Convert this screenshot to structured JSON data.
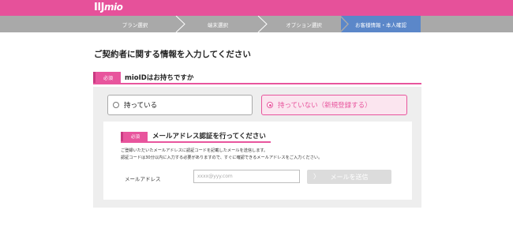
{
  "header": {
    "logo_main": "IIJ",
    "logo_sub": "mio"
  },
  "steps": [
    {
      "label": "プラン選択"
    },
    {
      "label": "端末選択"
    },
    {
      "label": "オプション選択"
    },
    {
      "label": "お客様情報・本人確認",
      "active": true
    }
  ],
  "page": {
    "title": "ご契約者に関する情報を入力してください"
  },
  "mioid_section": {
    "badge": "必須",
    "question": "mioIDはお持ちですか",
    "options": [
      {
        "label": "持っている",
        "selected": false
      },
      {
        "label": "持っていない（新規登録する）",
        "selected": true
      }
    ]
  },
  "email_section": {
    "badge": "必須",
    "title": "メールアドレス認証を行ってください",
    "desc_line1": "ご登録いただいたメールアドレスに認証コードを記載したメールを送信します。",
    "desc_line2": "認証コードは30分以内に入力する必要がありますので、すぐに確認できるメールアドレスをご入力ください。",
    "email_label": "メールアドレス",
    "email_placeholder": "xxxx@yyy.com",
    "email_value": "",
    "send_button": "メールを送信",
    "send_arrow": "〉"
  },
  "colors": {
    "brand_pink": "#e6519a",
    "active_step": "#5b87c9",
    "step_bar": "#a9a9a9"
  }
}
